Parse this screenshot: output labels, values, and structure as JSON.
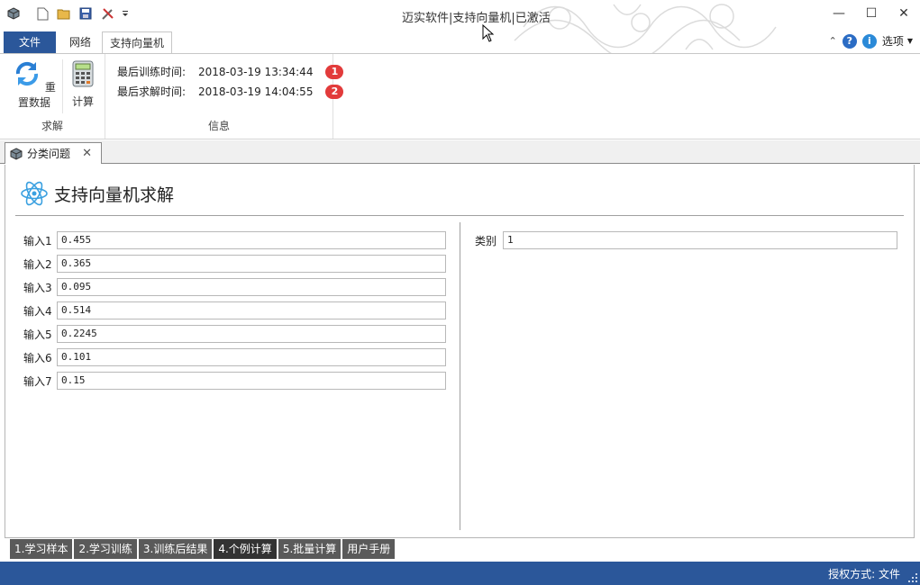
{
  "window": {
    "title": "迈实软件|支持向量机|已激活",
    "minimize": "—",
    "maximize": "☐",
    "close": "✕"
  },
  "ribbon_tabs": [
    {
      "label": "文件"
    },
    {
      "label": "网络"
    },
    {
      "label": "支持向量机"
    }
  ],
  "ribbon_right": {
    "options_label": "选项"
  },
  "groups": {
    "solve": {
      "label": "求解",
      "reset_label": "重置数据",
      "compute_label": "计算"
    },
    "info": {
      "label": "信息",
      "rows": [
        {
          "label": "最后训练时间:",
          "value": "2018-03-19 13:34:44",
          "badge": "1"
        },
        {
          "label": "最后求解时间:",
          "value": "2018-03-19 14:04:55",
          "badge": "2"
        }
      ]
    }
  },
  "doc_tab": {
    "label": "分类问题",
    "close": "✕"
  },
  "panel": {
    "title": "支持向量机求解",
    "inputs": [
      {
        "label": "输入1",
        "value": "0.455"
      },
      {
        "label": "输入2",
        "value": "0.365"
      },
      {
        "label": "输入3",
        "value": "0.095"
      },
      {
        "label": "输入4",
        "value": "0.514"
      },
      {
        "label": "输入5",
        "value": "0.2245"
      },
      {
        "label": "输入6",
        "value": "0.101"
      },
      {
        "label": "输入7",
        "value": "0.15"
      }
    ],
    "output": {
      "label": "类别",
      "value": "1"
    }
  },
  "nav_tabs": [
    {
      "label": "1.学习样本",
      "active": false
    },
    {
      "label": "2.学习训练",
      "active": false
    },
    {
      "label": "3.训练后结果",
      "active": false
    },
    {
      "label": "4.个例计算",
      "active": true
    },
    {
      "label": "5.批量计算",
      "active": false
    },
    {
      "label": "用户手册",
      "active": false
    }
  ],
  "status": {
    "text": "授权方式: 文件"
  },
  "colors": {
    "accent": "#2b579a",
    "badge": "#e23b3b",
    "nav_tab": "#5a5a5a",
    "nav_tab_active": "#333333"
  }
}
